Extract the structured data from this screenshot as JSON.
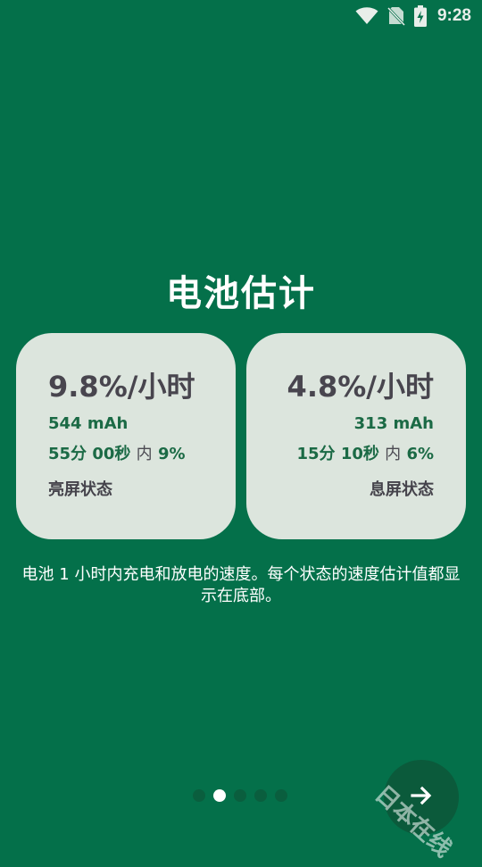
{
  "status_bar": {
    "time": "9:28",
    "icons": [
      "wifi-icon",
      "no-sim-icon",
      "battery-charging-icon"
    ]
  },
  "title": "电池估计",
  "cards": {
    "screen_on": {
      "rate": "9.8%/小时",
      "mah": "544 mAh",
      "duration": "55分 00秒",
      "in_label": "内",
      "percent": "9%",
      "state": "亮屏状态"
    },
    "screen_off": {
      "rate": "4.8%/小时",
      "mah": "313 mAh",
      "duration": "15分 10秒",
      "in_label": "内",
      "percent": "6%",
      "state": "息屏状态"
    }
  },
  "description": "电池 1 小时内充电和放电的速度。每个状态的速度估计值都显示在底部。",
  "pager": {
    "count": 5,
    "active_index": 1
  },
  "next_button_icon": "arrow-right-icon",
  "watermark": "日本在线",
  "colors": {
    "background": "#04704a",
    "card": "#dce5dd",
    "accent_green": "#1b6a45",
    "button": "#0b5a3b"
  }
}
